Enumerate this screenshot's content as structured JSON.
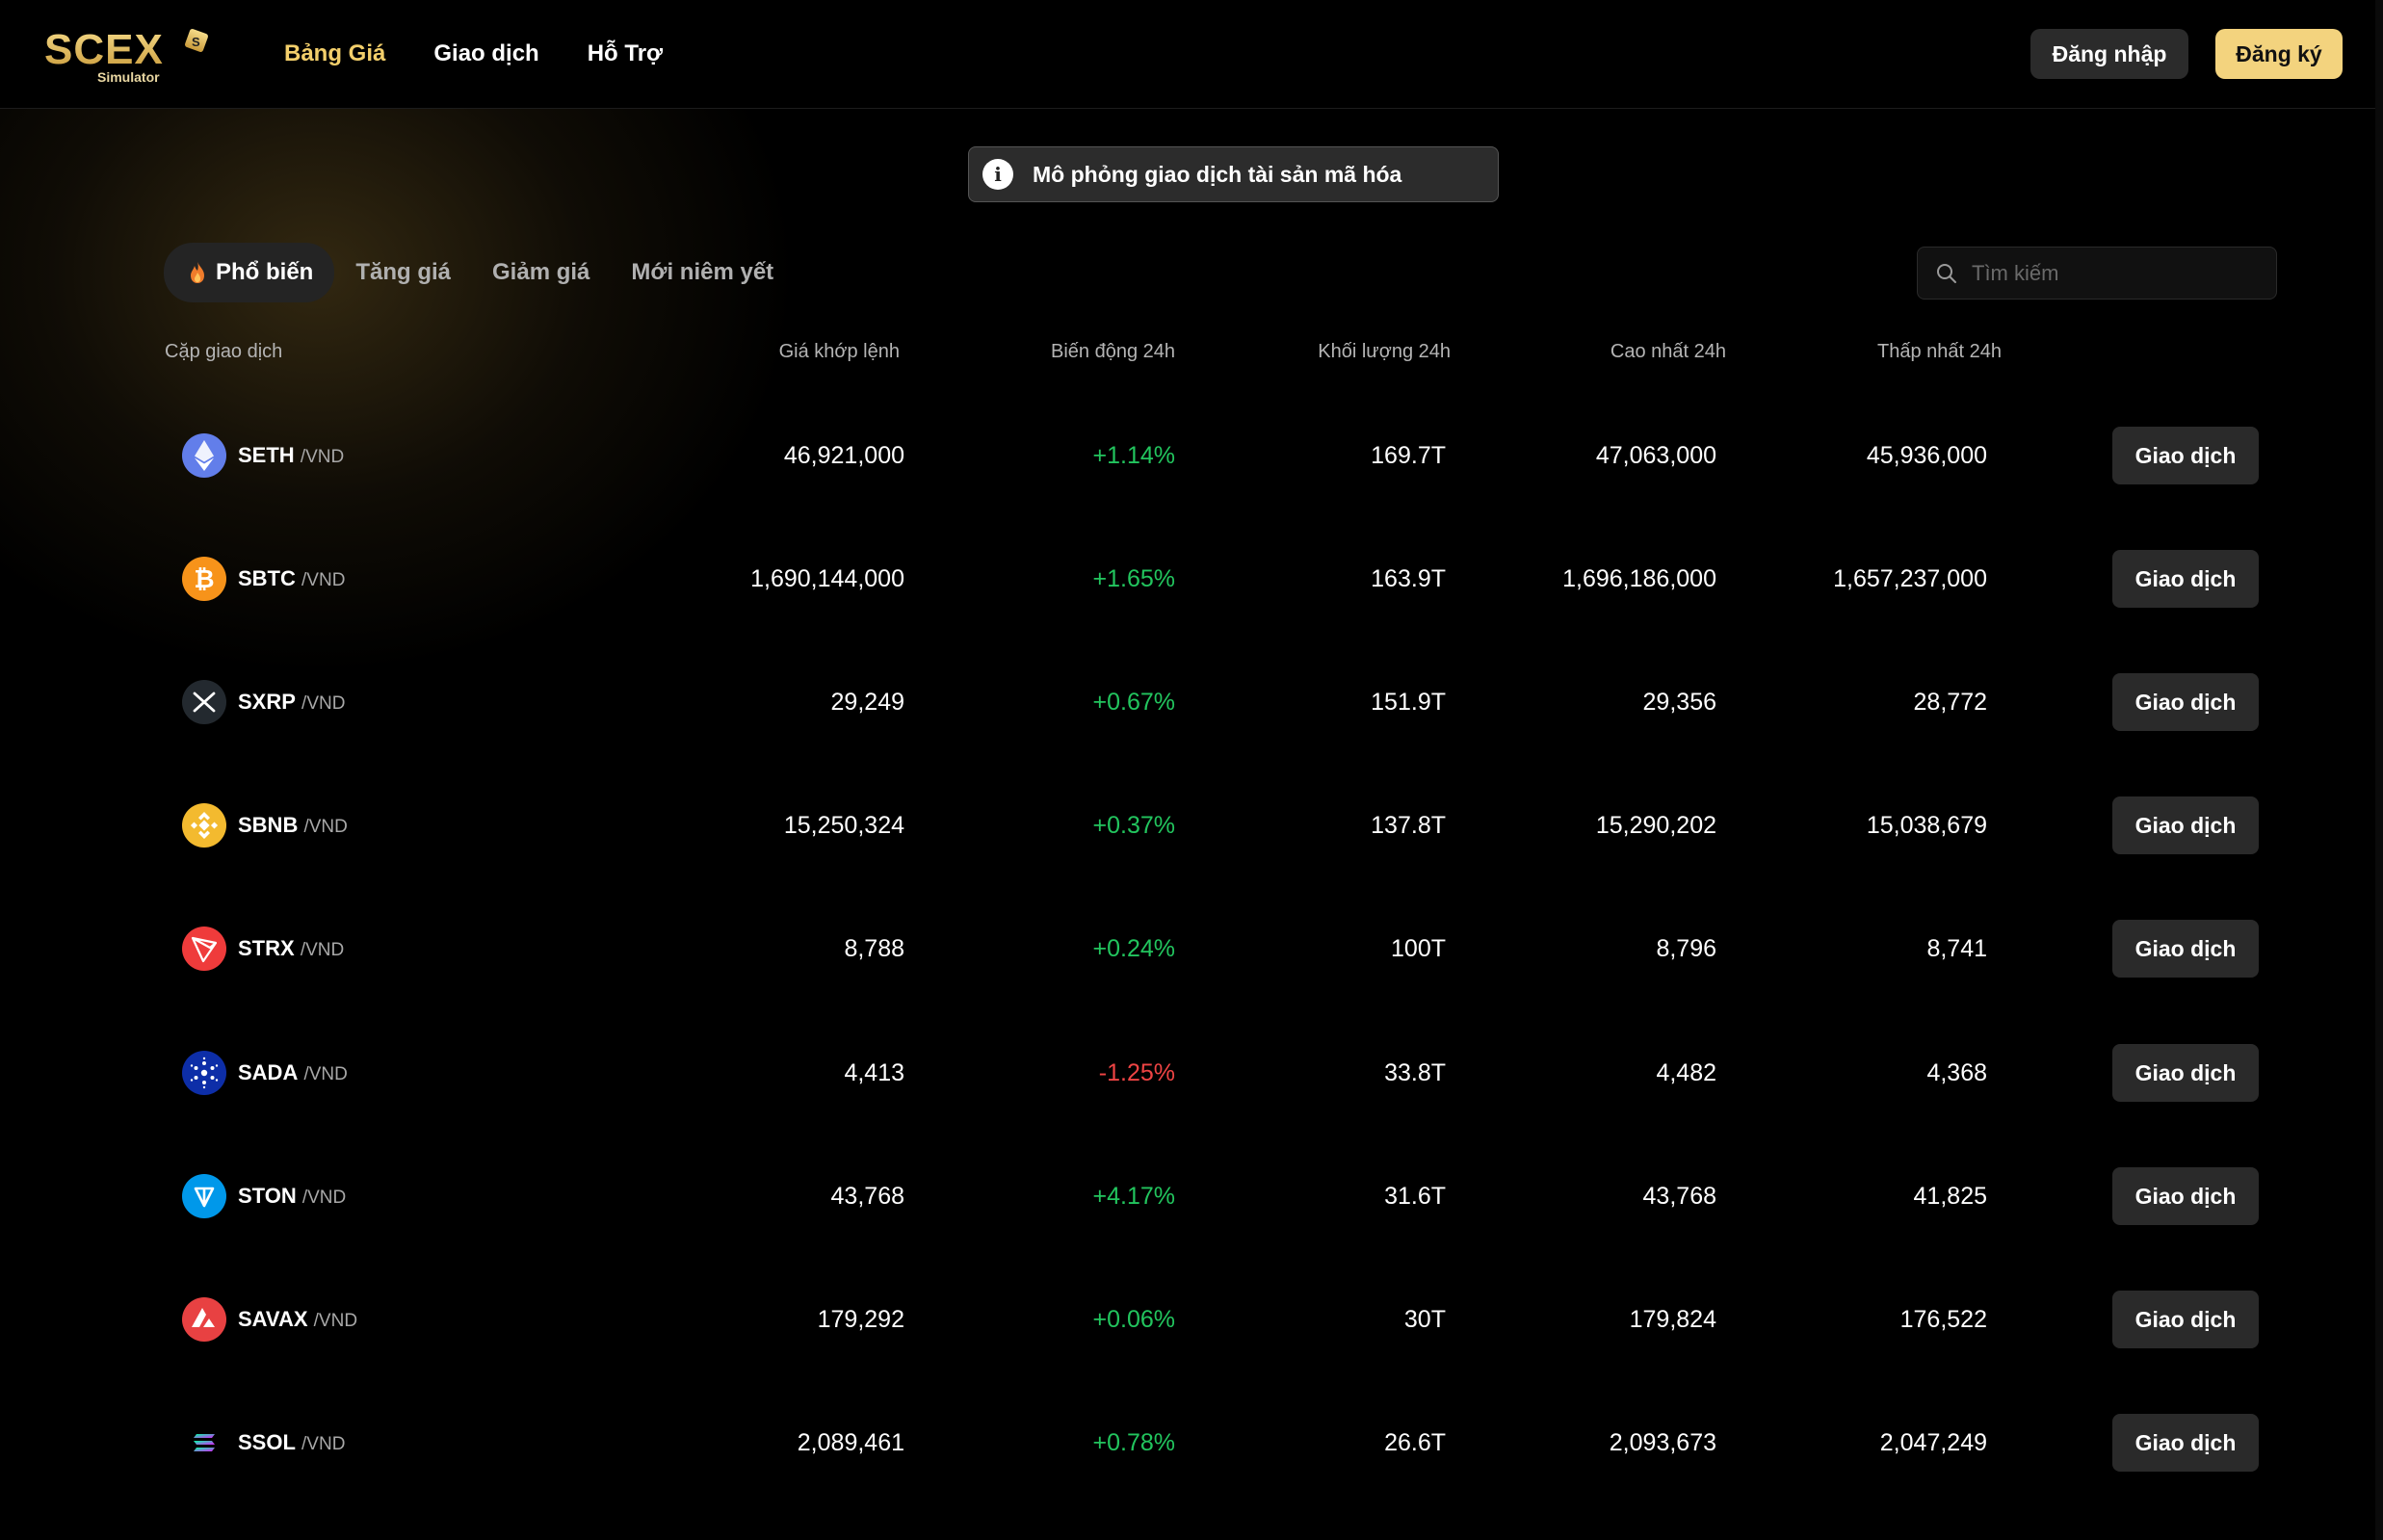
{
  "header": {
    "logo_text": "SCEX",
    "logo_sub": "Simulator",
    "nav": [
      {
        "label": "Bảng Giá",
        "active": true
      },
      {
        "label": "Giao dịch",
        "active": false
      },
      {
        "label": "Hỗ Trợ",
        "active": false
      }
    ],
    "login_label": "Đăng nhập",
    "register_label": "Đăng ký"
  },
  "notice": {
    "text": "Mô phỏng giao dịch tài sản mã hóa"
  },
  "tabs": [
    {
      "label": "Phổ biến",
      "active": true
    },
    {
      "label": "Tăng giá",
      "active": false
    },
    {
      "label": "Giảm giá",
      "active": false
    },
    {
      "label": "Mới niêm yết",
      "active": false
    }
  ],
  "search": {
    "placeholder": "Tìm kiếm"
  },
  "table": {
    "columns": [
      "Cặp giao dịch",
      "Giá khớp lệnh",
      "Biến động 24h",
      "Khối lượng 24h",
      "Cao nhất 24h",
      "Thấp nhất 24h"
    ],
    "trade_label": "Giao dịch",
    "rows": [
      {
        "symbol": "SETH",
        "quote": "/VND",
        "price": "46,921,000",
        "change": "+1.14%",
        "trend": "up",
        "volume": "169.7T",
        "high": "47,063,000",
        "low": "45,936,000",
        "icon": "ethereum-icon",
        "color": "#627eea"
      },
      {
        "symbol": "SBTC",
        "quote": "/VND",
        "price": "1,690,144,000",
        "change": "+1.65%",
        "trend": "up",
        "volume": "163.9T",
        "high": "1,696,186,000",
        "low": "1,657,237,000",
        "icon": "bitcoin-icon",
        "color": "#f7931a"
      },
      {
        "symbol": "SXRP",
        "quote": "/VND",
        "price": "29,249",
        "change": "+0.67%",
        "trend": "up",
        "volume": "151.9T",
        "high": "29,356",
        "low": "28,772",
        "icon": "xrp-icon",
        "color": "#23292f"
      },
      {
        "symbol": "SBNB",
        "quote": "/VND",
        "price": "15,250,324",
        "change": "+0.37%",
        "trend": "up",
        "volume": "137.8T",
        "high": "15,290,202",
        "low": "15,038,679",
        "icon": "bnb-icon",
        "color": "#f3ba2f"
      },
      {
        "symbol": "STRX",
        "quote": "/VND",
        "price": "8,788",
        "change": "+0.24%",
        "trend": "up",
        "volume": "100T",
        "high": "8,796",
        "low": "8,741",
        "icon": "tron-icon",
        "color": "#ef3b3b"
      },
      {
        "symbol": "SADA",
        "quote": "/VND",
        "price": "4,413",
        "change": "-1.25%",
        "trend": "down",
        "volume": "33.8T",
        "high": "4,482",
        "low": "4,368",
        "icon": "cardano-icon",
        "color": "#0d2ea8"
      },
      {
        "symbol": "STON",
        "quote": "/VND",
        "price": "43,768",
        "change": "+4.17%",
        "trend": "up",
        "volume": "31.6T",
        "high": "43,768",
        "low": "41,825",
        "icon": "toncoin-icon",
        "color": "#0098ea"
      },
      {
        "symbol": "SAVAX",
        "quote": "/VND",
        "price": "179,292",
        "change": "+0.06%",
        "trend": "up",
        "volume": "30T",
        "high": "179,824",
        "low": "176,522",
        "icon": "avalanche-icon",
        "color": "#e84142"
      },
      {
        "symbol": "SSOL",
        "quote": "/VND",
        "price": "2,089,461",
        "change": "+0.78%",
        "trend": "up",
        "volume": "26.6T",
        "high": "2,093,673",
        "low": "2,047,249",
        "icon": "solana-icon",
        "color": "#000000"
      }
    ]
  },
  "colors": {
    "accent": "#f3cf6b",
    "up": "#22c55e",
    "down": "#ef4444",
    "button_bg": "#2a2a2a"
  }
}
